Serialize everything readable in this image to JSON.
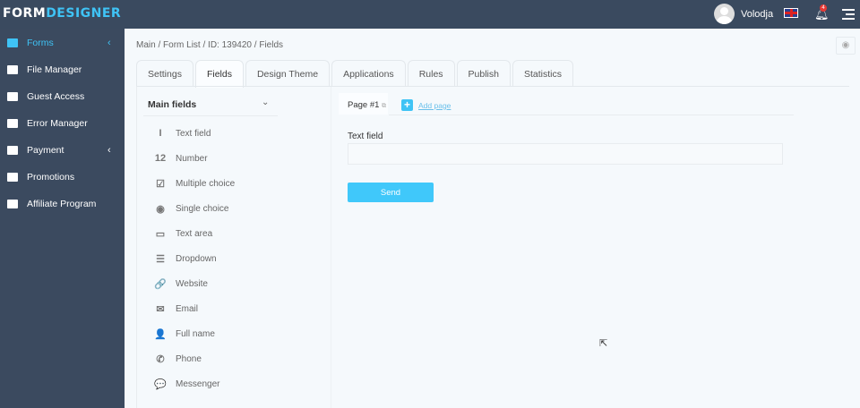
{
  "header": {
    "logo_a": "FORM",
    "logo_b": "DESIGNER",
    "user": "Volodja",
    "notifications": "4",
    "accent": "#3fc3f5"
  },
  "sidebar": {
    "items": [
      {
        "label": "Forms",
        "icon": "forms-icon",
        "active": true
      },
      {
        "label": "File Manager",
        "icon": "folder-icon"
      },
      {
        "label": "Guest Access",
        "icon": "user-circle-icon"
      },
      {
        "label": "Error Manager",
        "icon": "warning-icon"
      },
      {
        "label": "Payment",
        "icon": "card-icon"
      },
      {
        "label": "Promotions",
        "icon": "gift-icon"
      },
      {
        "label": "Affiliate Program",
        "icon": "dollar-icon"
      }
    ]
  },
  "breadcrumb": {
    "items": [
      "Main",
      "Form List",
      "ID: 139420",
      "Fields"
    ],
    "sep": " / "
  },
  "tabs": [
    "Settings",
    "Fields",
    "Design Theme",
    "Applications",
    "Rules",
    "Publish",
    "Statistics"
  ],
  "fields_panel": {
    "title": "Main fields",
    "items": [
      {
        "label": "Text field",
        "glyph": "I"
      },
      {
        "label": "Number",
        "glyph": "12"
      },
      {
        "label": "Multiple choice",
        "glyph": "☑"
      },
      {
        "label": "Single choice",
        "glyph": "◉"
      },
      {
        "label": "Text area",
        "glyph": "▭"
      },
      {
        "label": "Dropdown",
        "glyph": "☰"
      },
      {
        "label": "Website",
        "glyph": "🔗"
      },
      {
        "label": "Email",
        "glyph": "✉"
      },
      {
        "label": "Full name",
        "glyph": "👤"
      },
      {
        "label": "Phone",
        "glyph": "✆"
      },
      {
        "label": "Messenger",
        "glyph": "💬"
      }
    ]
  },
  "canvas": {
    "page_tab": "Page #1",
    "add_page": "Add page",
    "field_label": "Text field",
    "field_value": "",
    "send": "Send"
  }
}
